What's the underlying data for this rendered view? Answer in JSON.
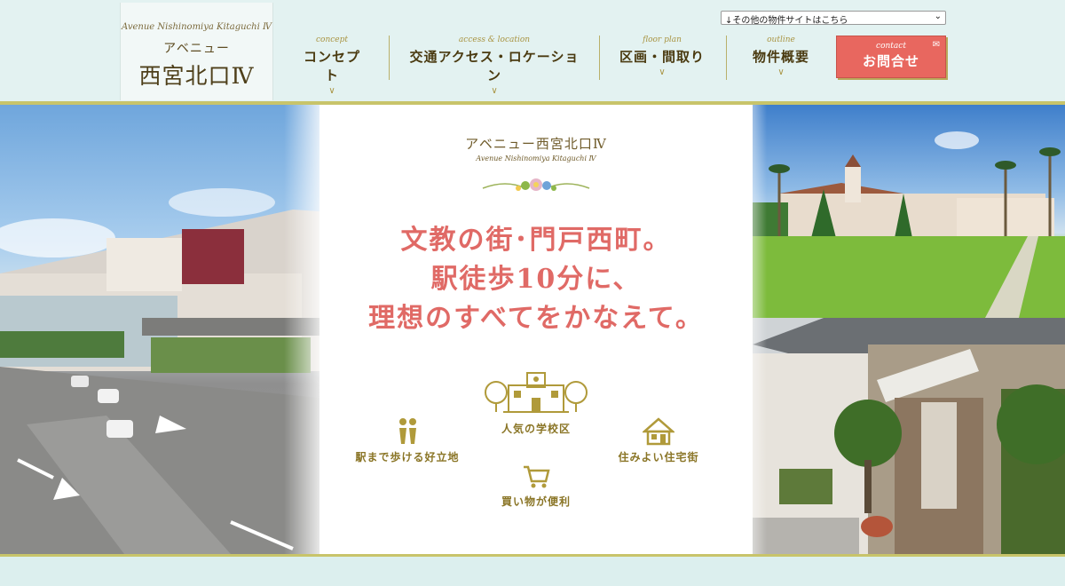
{
  "logo": {
    "en": "Avenue Nishinomiya Kitaguchi Ⅳ",
    "kana": "アベニュー",
    "main": "西宮北口Ⅳ"
  },
  "select": {
    "value": "↓その他の物件サイトはこちら"
  },
  "nav": [
    {
      "en": "concept",
      "jp": "コンセプト"
    },
    {
      "en": "access & location",
      "jp": "交通アクセス・ロケーション"
    },
    {
      "en": "floor plan",
      "jp": "区画・間取り"
    },
    {
      "en": "outline",
      "jp": "物件概要"
    }
  ],
  "contact": {
    "en": "contact",
    "jp": "お問合せ"
  },
  "hero": {
    "title": "アベニュー西宮北口Ⅳ",
    "subtitle": "Avenue Nishinomiya Kitaguchi Ⅳ",
    "headline": [
      "文教の街･門戸西町。",
      "駅徒歩10分に、",
      "理想のすべてをかなえて。"
    ],
    "features": {
      "school": "人気の学校区",
      "station": "駅まで歩ける好立地",
      "residential": "住みよい住宅街",
      "shopping": "買い物が便利"
    }
  },
  "colors": {
    "accent": "#e8675f",
    "gold": "#c8c46a",
    "headline": "#e06a66",
    "header_bg": "#e3f2f1"
  }
}
